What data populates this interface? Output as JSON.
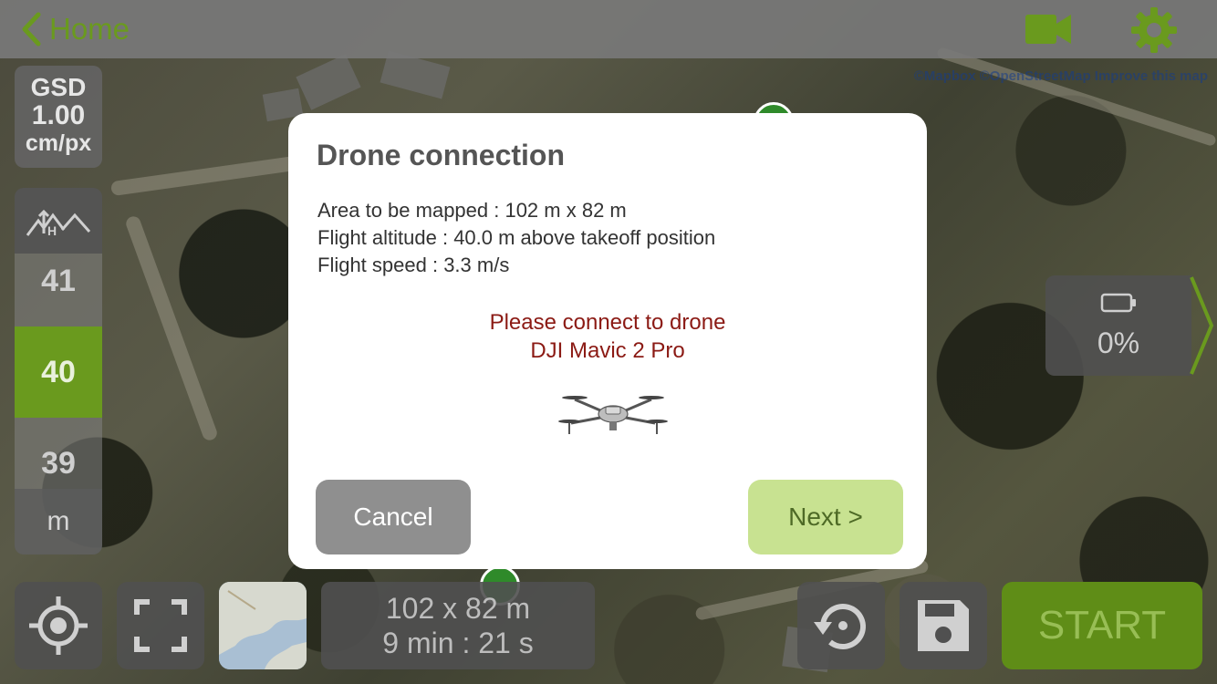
{
  "header": {
    "back_label": "Home"
  },
  "map": {
    "attribution": "©Mapbox ©OpenStreetMap Improve this map"
  },
  "gsd": {
    "label": "GSD",
    "value": "1.00",
    "unit": "cm/px"
  },
  "altitude": {
    "above": "41",
    "selected": "40",
    "below": "39",
    "unit": "m"
  },
  "battery": {
    "percent": "0%"
  },
  "bottom": {
    "area": "102 x 82 m",
    "duration": "9 min : 21 s",
    "start_label": "START"
  },
  "modal": {
    "title": "Drone connection",
    "area_line": "Area to be mapped : 102 m x 82 m",
    "altitude_line": "Flight altitude : 40.0 m above takeoff position",
    "speed_line": "Flight speed : 3.3 m/s",
    "message_line1": "Please connect to drone",
    "message_line2": "DJI Mavic 2 Pro",
    "cancel_label": "Cancel",
    "next_label": "Next >"
  },
  "colors": {
    "accent_green": "#6a9a1e",
    "start_green": "#5f8d17",
    "next_button": "#c8e291",
    "message_red": "#8b1a14"
  }
}
